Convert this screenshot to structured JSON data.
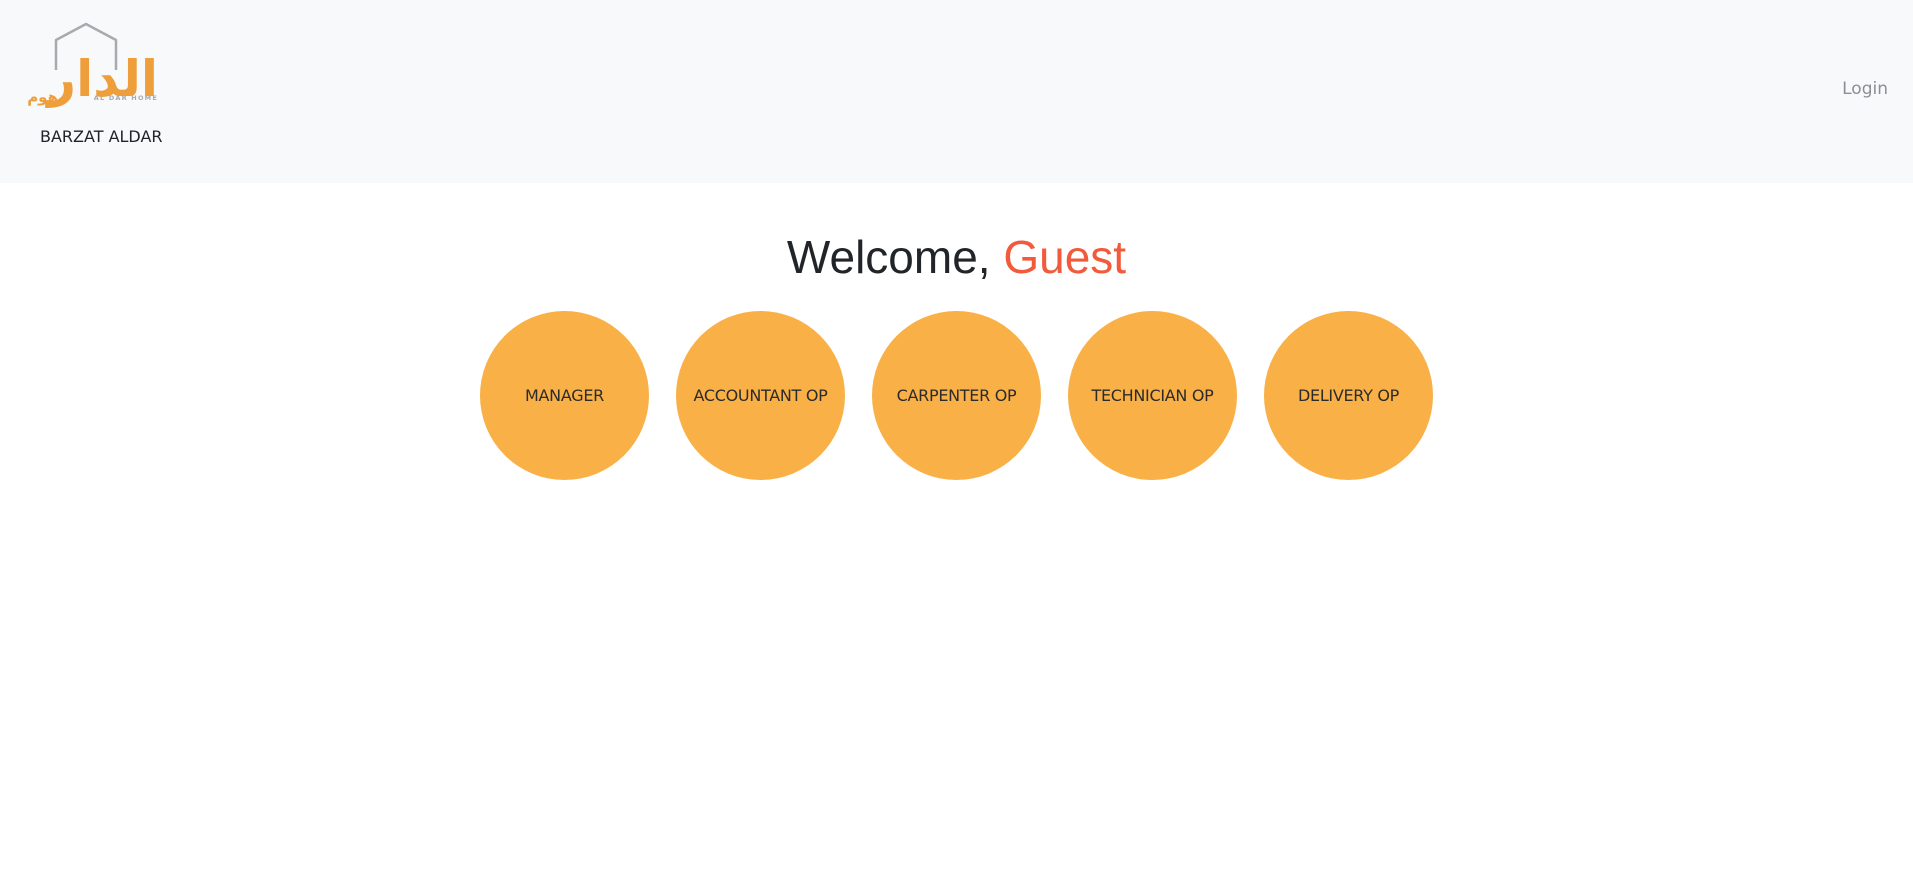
{
  "navbar": {
    "logo": {
      "arabic_wordmark": "الدار",
      "arabic_subword": "هوم",
      "latin_subtitle": "AL DAR HOME",
      "icon": "house-outline-icon",
      "colors": {
        "wordmark": "#ee9e3b",
        "house_outline": "#a9aaad"
      }
    },
    "brand_name": "BARZAT ALDAR",
    "login_label": "Login"
  },
  "welcome": {
    "greeting": "Welcome,",
    "user": "Guest"
  },
  "roles": [
    {
      "label": "MANAGER"
    },
    {
      "label": "ACCOUNTANT OP"
    },
    {
      "label": "CARPENTER OP"
    },
    {
      "label": "TECHNICIAN OP"
    },
    {
      "label": "DELIVERY OP"
    }
  ],
  "colors": {
    "navbar_bg": "#f8f9fa",
    "accent": "#f15a3a",
    "role_bg": "#f9b046"
  }
}
